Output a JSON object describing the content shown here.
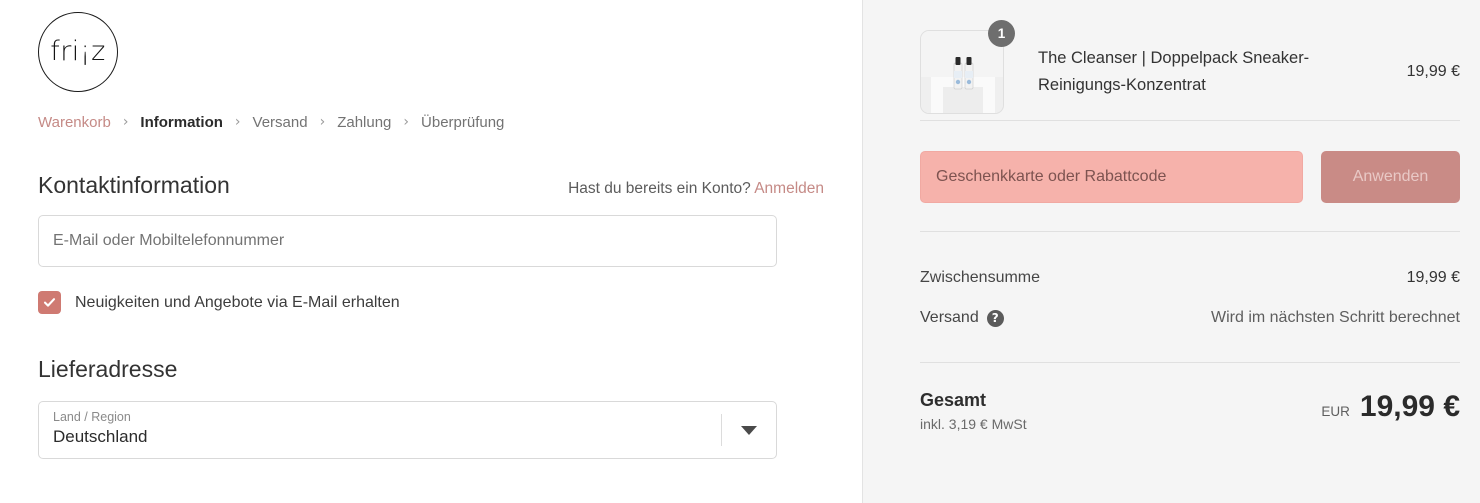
{
  "brand": {
    "logo_text": "fri¡z",
    "logo_icon": "circle-logo"
  },
  "breadcrumb": {
    "items": [
      {
        "label": "Warenkorb",
        "state": "link"
      },
      {
        "label": "Information",
        "state": "active"
      },
      {
        "label": "Versand",
        "state": "inactive"
      },
      {
        "label": "Zahlung",
        "state": "inactive"
      },
      {
        "label": "Überprüfung",
        "state": "inactive"
      }
    ],
    "separator": "›"
  },
  "contact": {
    "title": "Kontaktinformation",
    "account_question": "Hast du bereits ein Konto?",
    "login_link": "Anmelden",
    "email_placeholder": "E-Mail oder Mobiltelefonnummer",
    "email_value": "",
    "newsletter_label": "Neuigkeiten und Angebote via E-Mail erhalten",
    "newsletter_checked": true
  },
  "shipping_address": {
    "title": "Lieferadresse",
    "country_label": "Land / Region",
    "country_value": "Deutschland"
  },
  "summary": {
    "product": {
      "name": "The Cleanser | Doppelpack Sneaker-Reinigungs-Konzentrat",
      "price": "19,99 €",
      "quantity": "1",
      "image_alt": "product-thumbnail"
    },
    "discount": {
      "placeholder": "Geschenkkarte oder Rabattcode",
      "value": "",
      "apply_label": "Anwenden"
    },
    "subtotal_label": "Zwischensumme",
    "subtotal_value": "19,99 €",
    "shipping_label": "Versand",
    "shipping_value": "Wird im nächsten Schritt berechnet",
    "shipping_help_icon": "question-mark-icon",
    "total_label": "Gesamt",
    "total_tax_note": "inkl. 3,19 € MwSt",
    "total_currency": "EUR",
    "total_value": "19,99 €"
  },
  "colors": {
    "accent_rose": "#c58a86",
    "checkbox": "#cf7a72",
    "discount_field": "#f6b2ab",
    "apply_button": "#c98b86",
    "panel_bg": "#f5f5f5"
  }
}
